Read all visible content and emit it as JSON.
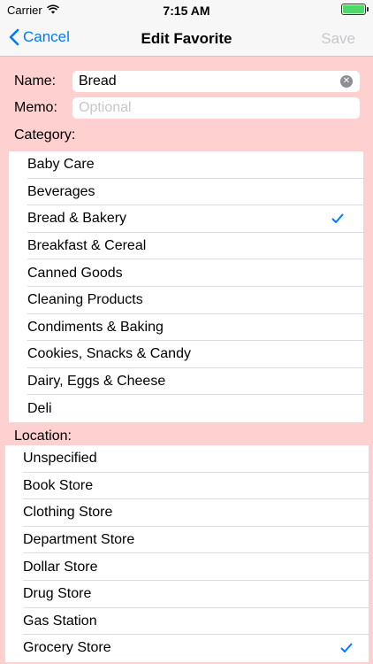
{
  "status": {
    "carrier": "Carrier",
    "time": "7:15 AM"
  },
  "nav": {
    "back_label": "Cancel",
    "title": "Edit Favorite",
    "save_label": "Save"
  },
  "form": {
    "name_label": "Name:",
    "name_value": "Bread",
    "memo_label": "Memo:",
    "memo_placeholder": "Optional"
  },
  "category": {
    "header": "Category:",
    "items": [
      {
        "label": "Baby Care",
        "selected": false
      },
      {
        "label": "Beverages",
        "selected": false
      },
      {
        "label": "Bread & Bakery",
        "selected": true
      },
      {
        "label": "Breakfast & Cereal",
        "selected": false
      },
      {
        "label": "Canned Goods",
        "selected": false
      },
      {
        "label": "Cleaning Products",
        "selected": false
      },
      {
        "label": "Condiments & Baking",
        "selected": false
      },
      {
        "label": "Cookies, Snacks & Candy",
        "selected": false
      },
      {
        "label": "Dairy, Eggs & Cheese",
        "selected": false
      },
      {
        "label": "Deli",
        "selected": false
      }
    ]
  },
  "location": {
    "header": "Location:",
    "items": [
      {
        "label": "Unspecified",
        "selected": false
      },
      {
        "label": "Book Store",
        "selected": false
      },
      {
        "label": "Clothing Store",
        "selected": false
      },
      {
        "label": "Department Store",
        "selected": false
      },
      {
        "label": "Dollar Store",
        "selected": false
      },
      {
        "label": "Drug Store",
        "selected": false
      },
      {
        "label": "Gas Station",
        "selected": false
      },
      {
        "label": "Grocery Store",
        "selected": true
      }
    ]
  },
  "colors": {
    "accent": "#007aff",
    "background": "#fed0d0",
    "disabled": "#c7c7cc"
  },
  "icons": {
    "back": "chevron-left-icon",
    "clear": "clear-circle-icon",
    "check": "checkmark-icon",
    "wifi": "wifi-icon",
    "battery": "battery-icon"
  }
}
